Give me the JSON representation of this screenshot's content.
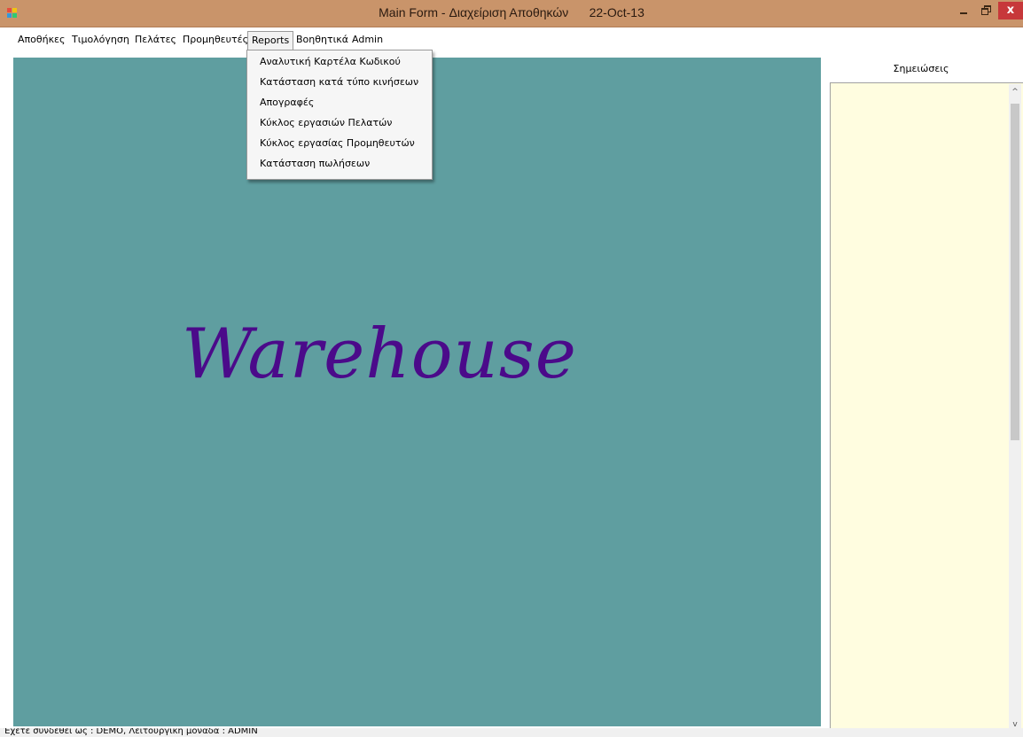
{
  "window": {
    "title": "Main Form - Διαχείριση Αποθηκών      22-Oct-13",
    "icon": "app-icon",
    "controls": {
      "minimize": "–",
      "close": "x"
    }
  },
  "menubar": {
    "items": [
      {
        "label": "Αποθήκες"
      },
      {
        "label": "Τιμολόγηση"
      },
      {
        "label": "Πελάτες"
      },
      {
        "label": "Προμηθευτές"
      },
      {
        "label": "Reports"
      },
      {
        "label": "Βοηθητικά"
      },
      {
        "label": "Admin"
      }
    ],
    "open_menu": "Reports"
  },
  "reports_menu": {
    "items": [
      {
        "label": "Αναλυτική Καρτέλα Κωδικού"
      },
      {
        "label": "Κατάσταση κατά τύπο κινήσεων"
      },
      {
        "label": "Απογραφές"
      },
      {
        "label": "Κύκλος εργασιών Πελατών"
      },
      {
        "label": "Κύκλος εργασίας Προμηθευτών"
      },
      {
        "label": "Κατάσταση πωλήσεων"
      }
    ]
  },
  "main": {
    "logo_text": "Warehouse",
    "background_color": "#5f9ea0",
    "logo_color": "#4b0a8a"
  },
  "notes": {
    "header": "Σημειώσεις",
    "value": "",
    "background_color": "#fffde0",
    "scroll_up": "^",
    "scroll_down": "v"
  },
  "status": {
    "text": "Έχετε συνδεθεί ως : DEMO, Λειτουργική μονάδα : ADMIN"
  },
  "colors": {
    "titlebar": "#c9946a",
    "close_button": "#c7383a"
  }
}
